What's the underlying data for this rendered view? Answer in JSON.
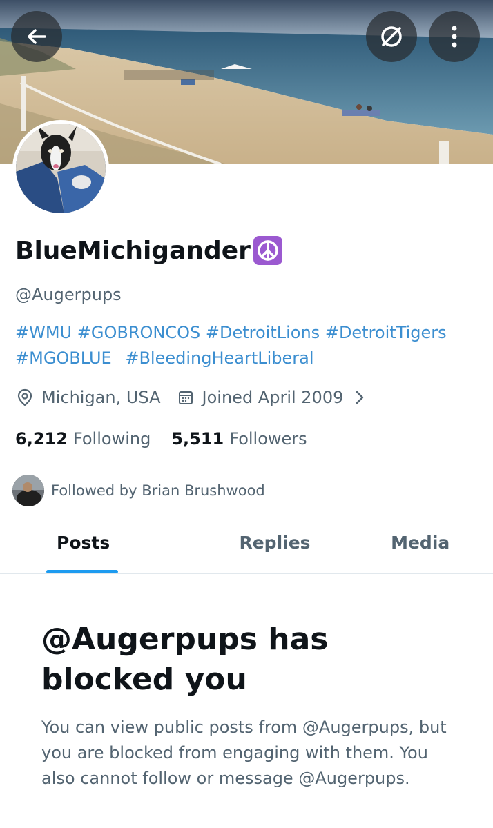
{
  "header": {
    "back_icon": "arrow-left-icon",
    "mute_icon": "blocked-circle-icon",
    "more_icon": "more-vertical-icon"
  },
  "profile": {
    "display_name": "BlueMichigander",
    "name_emoji": "peace-symbol-emoji",
    "handle": "@Augerpups",
    "bio_line1": [
      "#WMU",
      "#GOBRONCOS",
      "#DetroitLions",
      "#DetroitTigers"
    ],
    "bio_line2": [
      "#MGOBLUE",
      "#BleedingHeartLiberal"
    ],
    "location": "Michigan, USA",
    "joined": "Joined April 2009",
    "following_count": "6,212",
    "following_label": "Following",
    "followers_count": "5,511",
    "followers_label": "Followers",
    "followed_by": "Followed by Brian Brushwood"
  },
  "tabs": [
    {
      "label": "Posts",
      "active": true
    },
    {
      "label": "Replies",
      "active": false
    },
    {
      "label": "Media",
      "active": false
    }
  ],
  "blocked": {
    "title": "@Augerpups has blocked you",
    "body": "You can view public posts from @Augerpups, but you are blocked from engaging with them. You also cannot follow or message @Augerpups."
  },
  "colors": {
    "link": "#3b8ed0",
    "accent": "#1d9bf0",
    "secondary_text": "#536471",
    "primary_text": "#0f1419"
  }
}
